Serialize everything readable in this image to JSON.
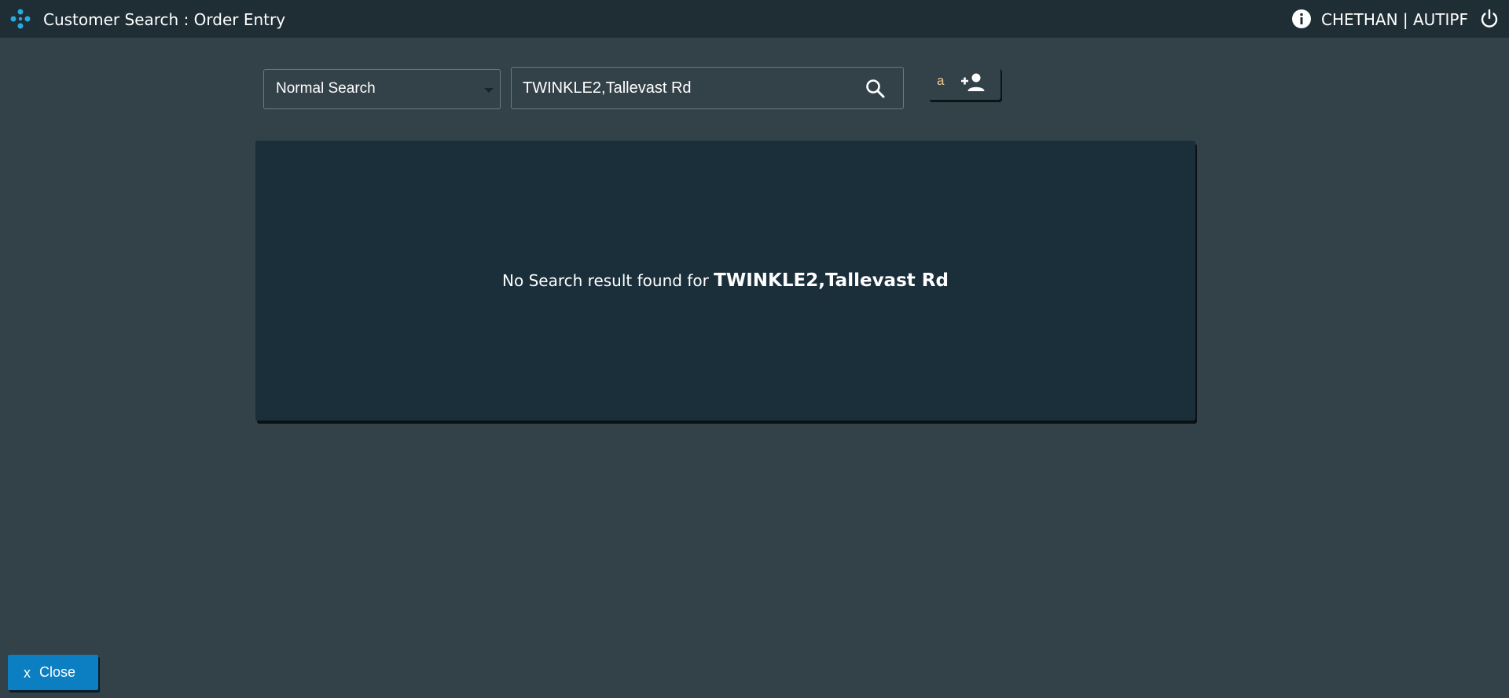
{
  "header": {
    "title": "Customer Search : Order Entry",
    "user": "CHETHAN | AUTIPF",
    "logo_icon": "dots-logo-icon",
    "info_icon": "info-icon",
    "power_icon": "power-icon"
  },
  "search": {
    "mode_selected": "Normal Search",
    "query_value": "TWINKLE2,Tallevast Rd",
    "search_icon": "search-icon"
  },
  "add_customer": {
    "letter": "a",
    "icon": "add-user-icon"
  },
  "results": {
    "message_prefix": "No Search result found for",
    "query": "TWINKLE2,Tallevast Rd"
  },
  "footer": {
    "close_x": "x",
    "close_label": "Close"
  },
  "colors": {
    "background": "#334149",
    "header": "#1f2d35",
    "panel": "#1b2f3a",
    "accent_blue": "#0b7fc2",
    "logo_blue": "#29a9e0"
  }
}
